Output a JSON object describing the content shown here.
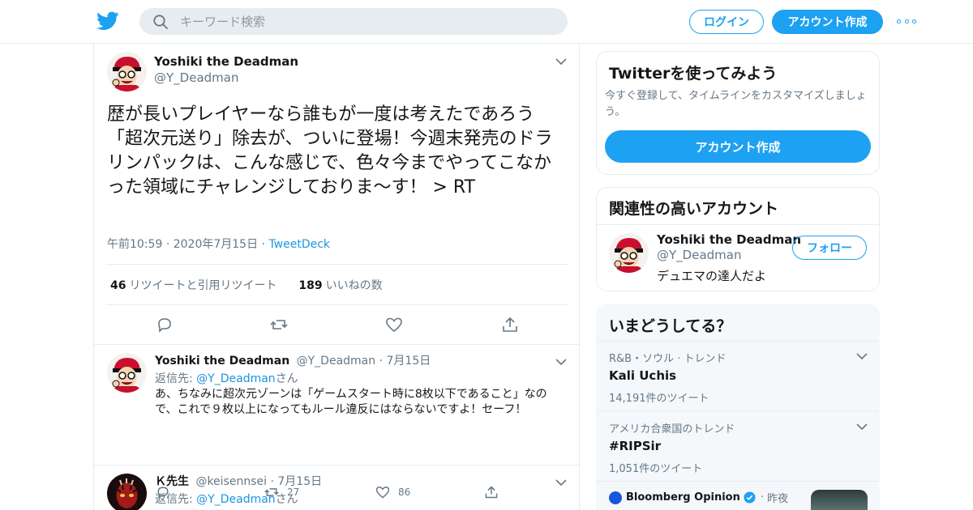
{
  "header": {
    "logo_icon": "twitter-bird-icon",
    "search_placeholder": "キーワード検索",
    "login_label": "ログイン",
    "signup_label": "アカウント作成",
    "accent_color": "#1da1f2"
  },
  "main_tweet": {
    "name": "Yoshiki the Deadman",
    "handle": "@Y_Deadman",
    "text": "歴が長いプレイヤーなら誰もが一度は考えたであろう「超次元送り」除去が、ついに登場！今週末発売のドラリンパックは、こんな感じで、色々今までやってこなかった領域にチャレンジしておりま〜す！ > RT",
    "time": "午前10:59",
    "date": "2020年7月15日",
    "source": "TweetDeck",
    "retweet_count": "46",
    "retweet_label": "リツイートと引用リツイート",
    "like_count": "189",
    "like_label": "いいねの数"
  },
  "replies": [
    {
      "name": "Yoshiki the Deadman",
      "handle": "@Y_Deadman",
      "date": "7月15日",
      "reply_prefix": "返信先: ",
      "reply_to": "@Y_Deadman",
      "reply_suffix": "さん",
      "text": "あ、ちなみに超次元ゾーンは「ゲームスタート時に8枚以下であること」なので、これで９枚以上になってもルール違反にはならないですよ！セーフ！",
      "retweets": "27",
      "likes": "86"
    },
    {
      "name": "Ｋ先生",
      "handle": "@keisennsei",
      "date": "7月15日",
      "reply_prefix": "返信先: ",
      "reply_to": "@Y_Deadman",
      "reply_suffix": "さん"
    }
  ],
  "sidebar": {
    "signup_card": {
      "title": "Twitterを使ってみよう",
      "subtitle": "今すぐ登録して、タイムラインをカスタマイズしましょう。",
      "button": "アカウント作成"
    },
    "related_card": {
      "title": "関連性の高いアカウント",
      "name": "Yoshiki the Deadman",
      "handle": "@Y_Deadman",
      "bio": "デュエマの達人だよ",
      "follow_label": "フォロー"
    },
    "trends_card": {
      "title": "いまどうしてる？",
      "trends": [
        {
          "category": "R&B・ソウル · トレンド",
          "name": "Kali Uchis",
          "count": "14,191件のツイート"
        },
        {
          "category": "アメリカ合衆国のトレンド",
          "name": "#RIPSir",
          "count": "1,051件のツイート"
        }
      ],
      "news": {
        "source": "Bloomberg Opinion",
        "time": "昨夜"
      }
    }
  }
}
